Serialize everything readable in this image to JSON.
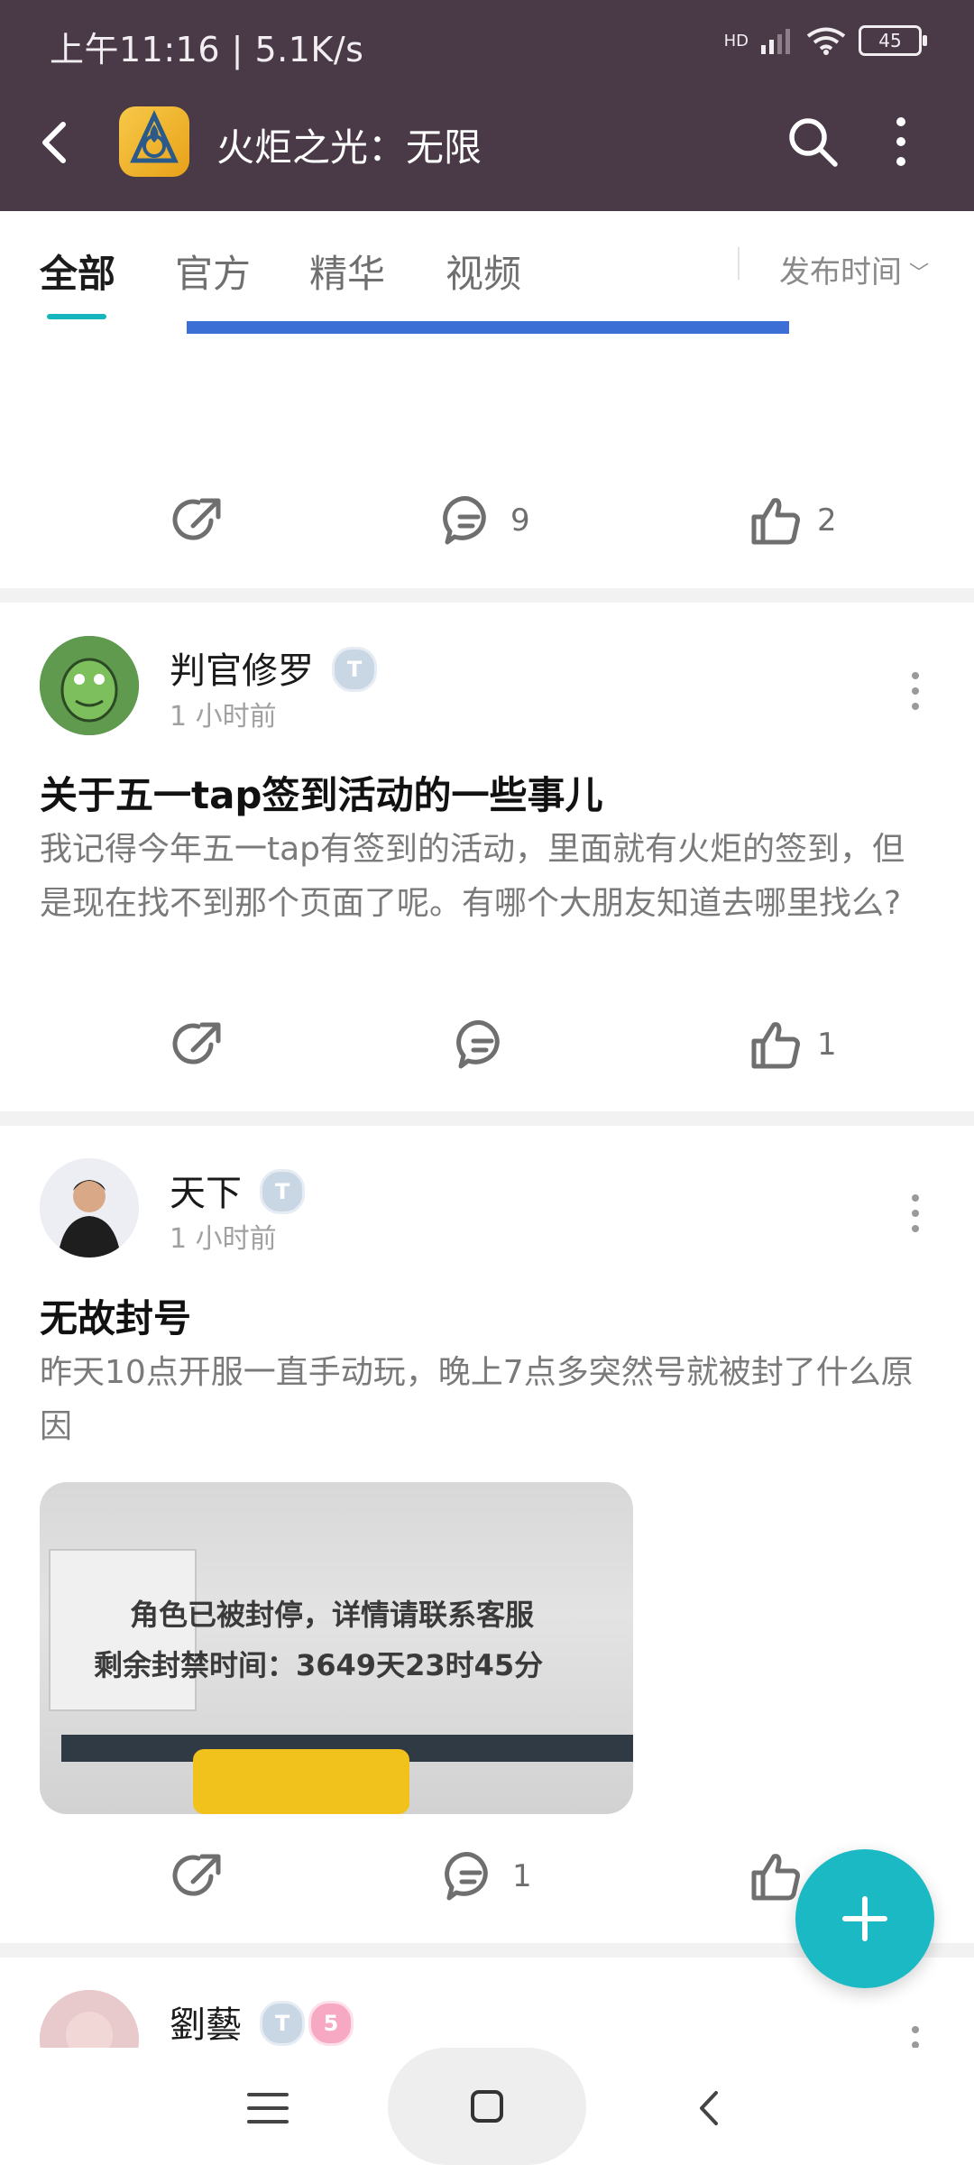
{
  "status_bar": {
    "time": "上午11:16 | 5.1K/s",
    "battery": "45",
    "network": "HD"
  },
  "header": {
    "title": "火炬之光：无限"
  },
  "tabs": {
    "items": [
      "全部",
      "官方",
      "精华",
      "视频"
    ],
    "active_index": 0,
    "sort_label": "发布时间"
  },
  "top_post_actions": {
    "comments": "9",
    "likes": "2"
  },
  "posts": [
    {
      "author": "判官修罗",
      "badge": "T",
      "time": "1 小时前",
      "title": "关于五一tap签到活动的一些事儿",
      "body": "我记得今年五一tap有签到的活动，里面就有火炬的签到，但是现在找不到那个页面了呢。有哪个大朋友知道去哪里找么?",
      "comments": "",
      "likes": "1"
    },
    {
      "author": "天下",
      "badge": "T",
      "time": "1 小时前",
      "title": "无故封号",
      "body": "昨天10点开服一直手动玩，晚上7点多突然号就被封了什么原因",
      "image_lines": [
        "角色已被封停，详情请联系客服",
        "剩余封禁时间：3649天23时45分"
      ],
      "comments": "1",
      "likes": ""
    },
    {
      "author": "劉藝",
      "badge": "T",
      "badge2": "5"
    }
  ],
  "colors": {
    "header_bg": "#4a3a47",
    "accent": "#1ab9c3"
  },
  "icons": {
    "share": "share-icon",
    "comment": "comment-icon",
    "like": "thumbs-up-icon",
    "search": "search-icon",
    "more": "more-vertical-icon",
    "add": "plus-icon"
  }
}
